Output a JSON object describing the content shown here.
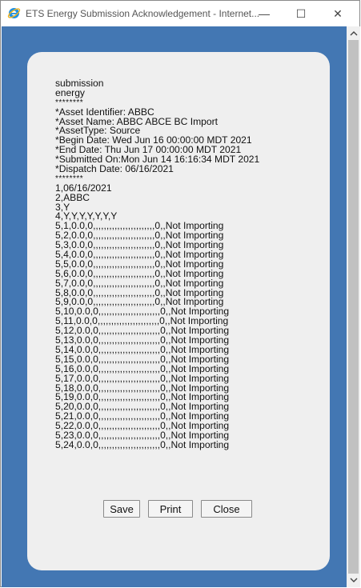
{
  "window": {
    "title": "ETS Energy Submission Acknowledgement - Internet...",
    "minimize_glyph": "—",
    "maximize_glyph": "☐",
    "close_glyph": "✕",
    "icon": "ie-icon"
  },
  "colors": {
    "background": "#4377b3",
    "panel": "#efefef",
    "ie_blue": "#1e90e3",
    "ie_ring": "#f2b31c"
  },
  "document": {
    "lines": [
      "submission",
      "energy",
      "********",
      "*Asset Identifier: ABBC",
      "*Asset Name: ABBC ABCE BC Import",
      "*AssetType: Source",
      "*Begin Date: Wed Jun 16 00:00:00 MDT 2021",
      "*End Date: Thu Jun 17 00:00:00 MDT 2021",
      "*Submitted On:Mon Jun 14 16:16:34 MDT 2021",
      "*Dispatch Date: 06/16/2021",
      "********",
      "1,06/16/2021",
      "2,ABBC",
      "3,Y",
      "4,Y,Y,Y,Y,Y,Y,Y",
      "5,1,0.0,0,,,,,,,,,,,,,,,,,,,,,,,0,,Not Importing",
      "5,2,0.0,0,,,,,,,,,,,,,,,,,,,,,,,0,,Not Importing",
      "5,3,0.0,0,,,,,,,,,,,,,,,,,,,,,,,0,,Not Importing",
      "5,4,0.0,0,,,,,,,,,,,,,,,,,,,,,,,0,,Not Importing",
      "5,5,0.0,0,,,,,,,,,,,,,,,,,,,,,,,0,,Not Importing",
      "5,6,0.0,0,,,,,,,,,,,,,,,,,,,,,,,0,,Not Importing",
      "5,7,0.0,0,,,,,,,,,,,,,,,,,,,,,,,0,,Not Importing",
      "5,8,0.0,0,,,,,,,,,,,,,,,,,,,,,,,0,,Not Importing",
      "5,9,0.0,0,,,,,,,,,,,,,,,,,,,,,,,0,,Not Importing",
      "5,10,0.0,0,,,,,,,,,,,,,,,,,,,,,,,0,,Not Importing",
      "5,11,0.0,0,,,,,,,,,,,,,,,,,,,,,,,0,,Not Importing",
      "5,12,0.0,0,,,,,,,,,,,,,,,,,,,,,,,0,,Not Importing",
      "5,13,0.0,0,,,,,,,,,,,,,,,,,,,,,,,0,,Not Importing",
      "5,14,0.0,0,,,,,,,,,,,,,,,,,,,,,,,0,,Not Importing",
      "5,15,0.0,0,,,,,,,,,,,,,,,,,,,,,,,0,,Not Importing",
      "5,16,0.0,0,,,,,,,,,,,,,,,,,,,,,,,0,,Not Importing",
      "5,17,0.0,0,,,,,,,,,,,,,,,,,,,,,,,0,,Not Importing",
      "5,18,0.0,0,,,,,,,,,,,,,,,,,,,,,,,0,,Not Importing",
      "5,19,0.0,0,,,,,,,,,,,,,,,,,,,,,,,0,,Not Importing",
      "5,20,0.0,0,,,,,,,,,,,,,,,,,,,,,,,0,,Not Importing",
      "5,21,0.0,0,,,,,,,,,,,,,,,,,,,,,,,0,,Not Importing",
      "5,22,0.0,0,,,,,,,,,,,,,,,,,,,,,,,0,,Not Importing",
      "5,23,0.0,0,,,,,,,,,,,,,,,,,,,,,,,0,,Not Importing",
      "5,24,0.0,0,,,,,,,,,,,,,,,,,,,,,,,0,,Not Importing"
    ]
  },
  "buttons": {
    "save": "Save",
    "print": "Print",
    "close": "Close"
  },
  "scrollbar": {
    "up_glyph": "^",
    "down_glyph": "v"
  }
}
